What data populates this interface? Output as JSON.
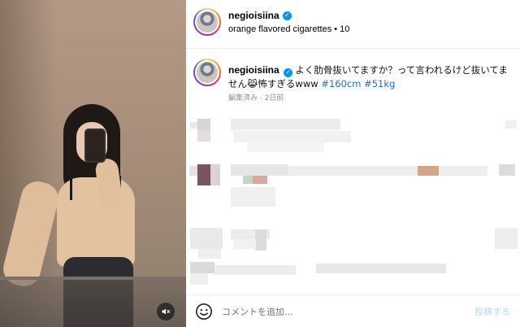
{
  "post": {
    "username": "negioisiina",
    "audio": "orange flavored cigarettes • 10",
    "caption_text": "よく肋骨抜いてますか？って言われるけど抜いてません😹怖すぎるwww",
    "hashtags": [
      "#160cm",
      "#51kg"
    ],
    "meta": "編集済み · 2日前"
  },
  "footer": {
    "comment_placeholder": "コメントを追加...",
    "post_label": "投稿する"
  },
  "colors": {
    "accent": "#0095f6",
    "post_disabled": "#b3dbff",
    "hashtag": "#1f6fd1"
  },
  "icons": {
    "verified": "verified-badge-icon",
    "mute": "speaker-muted-icon",
    "emoji": "smiley-icon"
  }
}
